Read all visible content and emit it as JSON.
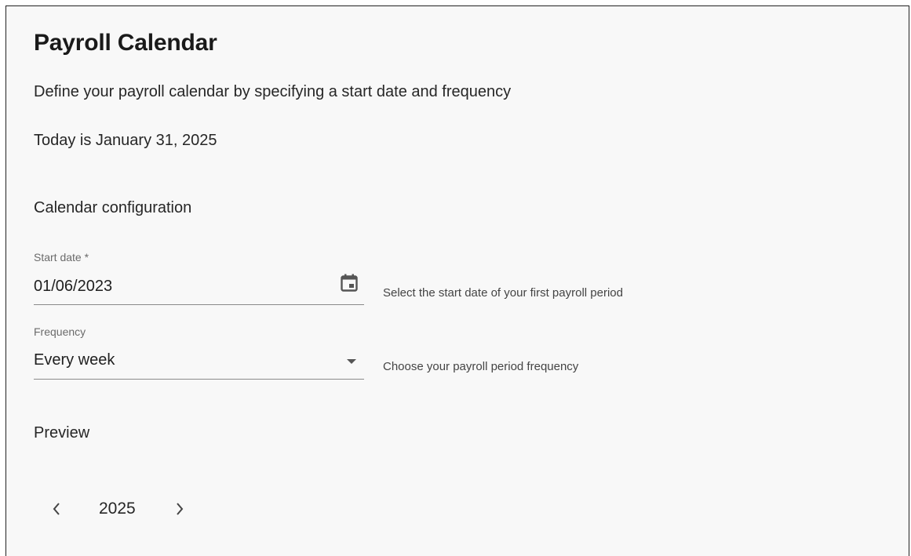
{
  "header": {
    "title": "Payroll Calendar",
    "subtitle": "Define your payroll calendar by specifying a start date and frequency",
    "today_text": "Today is January 31, 2025"
  },
  "config": {
    "heading": "Calendar configuration",
    "start_date": {
      "label": "Start date *",
      "value": "01/06/2023",
      "helper": "Select the start date of your first payroll period",
      "icon": "calendar-icon"
    },
    "frequency": {
      "label": "Frequency",
      "value": "Every week",
      "helper": "Choose your payroll period frequency",
      "icon": "dropdown-arrow-icon"
    }
  },
  "preview": {
    "heading": "Preview",
    "year": "2025",
    "prev_icon": "chevron-left-icon",
    "next_icon": "chevron-right-icon"
  },
  "colors": {
    "background": "#f8f8f8",
    "text": "#1f1f1f",
    "muted": "#6b6b6b",
    "underline": "#8a8a8a"
  }
}
